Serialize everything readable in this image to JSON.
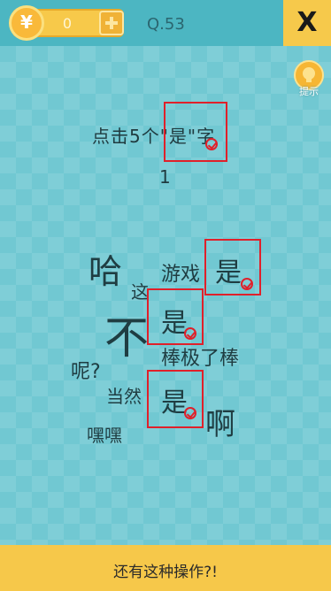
{
  "topbar": {
    "coin_symbol": "¥",
    "coin_count": "0",
    "level": "Q.53",
    "close_label": "X"
  },
  "hint": {
    "label": "提示"
  },
  "question": {
    "text": "点击5个\"是\"字",
    "sub": "1"
  },
  "words": {
    "ha": "哈",
    "zhe": "这",
    "youxi": "游戏",
    "shi1": "是",
    "bu": "不",
    "shi2": "是",
    "bangjilebang": "棒极了棒",
    "ne": "呢?",
    "dangran": "当然",
    "shi3": "是",
    "a": "啊",
    "heihei": "嘿嘿",
    "shi_question": "是"
  },
  "bottom": {
    "text": "还有这种操作?!"
  },
  "colors": {
    "background": "#71c8d2",
    "topbar": "#4cb6c2",
    "accent": "#f6c84a",
    "found_box": "#e0202a",
    "text": "#1f3d42"
  }
}
